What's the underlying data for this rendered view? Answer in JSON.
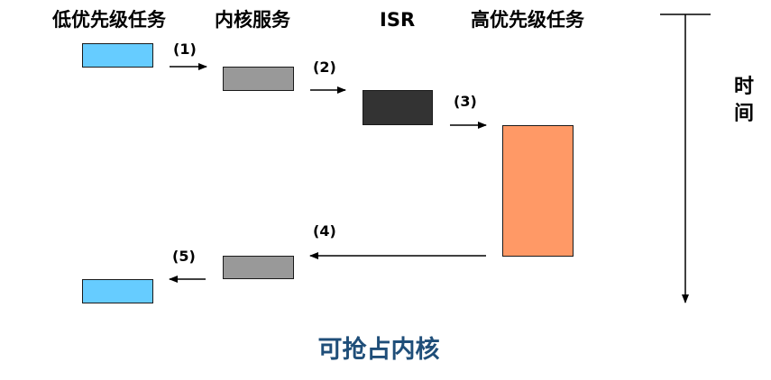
{
  "headers": {
    "low_priority_task": "低优先级任务",
    "kernel_service": "内核服务",
    "isr": "ISR",
    "high_priority_task": "高优先级任务"
  },
  "steps": [
    "(1)",
    "(2)",
    "(3)",
    "(4)",
    "(5)"
  ],
  "time_axis": {
    "label_line1": "时",
    "label_line2": "间"
  },
  "caption": "可抢占内核",
  "colors": {
    "low_priority_task": "#66ccff",
    "kernel_service": "#999999",
    "isr": "#333333",
    "high_priority_task": "#ff9966",
    "caption": "#1f4e79"
  }
}
